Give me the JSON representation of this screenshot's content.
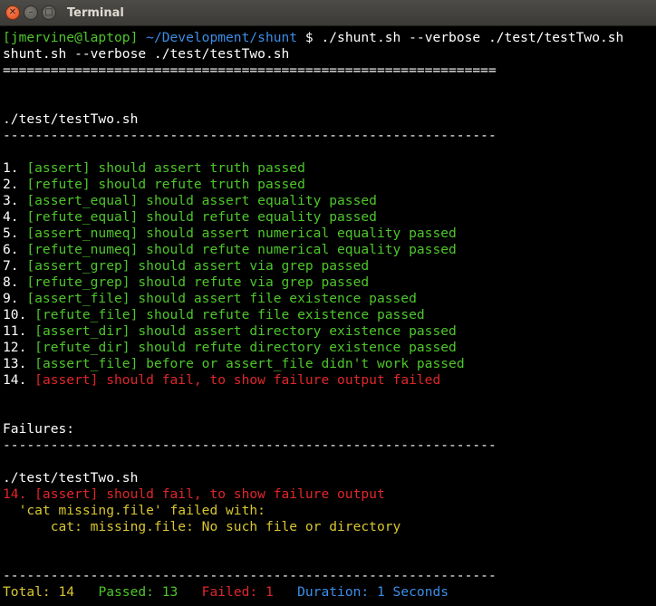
{
  "window": {
    "title": "Terminal",
    "buttons": {
      "close": "✕",
      "minimize": "–",
      "maximize": "□"
    }
  },
  "prompt": {
    "user_host": "[jmervine@laptop]",
    "path": " ~/Development/shunt",
    "symbol": " $ ",
    "command": "./shunt.sh --verbose ./test/testTwo.sh"
  },
  "echo_line": "shunt.sh --verbose ./test/testTwo.sh",
  "separator_double": "==============================================================",
  "section_file": "./test/testTwo.sh",
  "separator_dash": "--------------------------------------------------------------",
  "results": [
    {
      "num": "1. ",
      "text": "[assert] should assert truth passed",
      "status": "pass"
    },
    {
      "num": "2. ",
      "text": "[refute] should refute truth passed",
      "status": "pass"
    },
    {
      "num": "3. ",
      "text": "[assert_equal] should assert equality passed",
      "status": "pass"
    },
    {
      "num": "4. ",
      "text": "[refute_equal] should refute equality passed",
      "status": "pass"
    },
    {
      "num": "5. ",
      "text": "[assert_numeq] should assert numerical equality passed",
      "status": "pass"
    },
    {
      "num": "6. ",
      "text": "[refute_numeq] should refute numerical equality passed",
      "status": "pass"
    },
    {
      "num": "7. ",
      "text": "[assert_grep] should assert via grep passed",
      "status": "pass"
    },
    {
      "num": "8. ",
      "text": "[refute_grep] should refute via grep passed",
      "status": "pass"
    },
    {
      "num": "9. ",
      "text": "[assert_file] should assert file existence passed",
      "status": "pass"
    },
    {
      "num": "10. ",
      "text": "[refute_file] should refute file existence passed",
      "status": "pass"
    },
    {
      "num": "11. ",
      "text": "[assert_dir] should assert directory existence passed",
      "status": "pass"
    },
    {
      "num": "12. ",
      "text": "[refute_dir] should refute directory existence passed",
      "status": "pass"
    },
    {
      "num": "13. ",
      "text": "[assert_file] before or assert_file didn't work passed",
      "status": "pass"
    },
    {
      "num": "14. ",
      "text": "[assert] should fail, to show failure output failed",
      "status": "fail"
    }
  ],
  "failures": {
    "heading": "Failures:",
    "file": "./test/testTwo.sh",
    "item": "14. [assert] should fail, to show failure output",
    "detail_1": "  'cat missing.file' failed with:",
    "detail_2": "      cat: missing.file: No such file or directory"
  },
  "summary": {
    "total": "Total: 14",
    "passed": "Passed: 13",
    "failed": "Failed: 1",
    "duration_label": "Duration:",
    "duration_value": " 1 Seconds"
  },
  "colors": {
    "pass": "#4ec62b",
    "fail": "#e0262b",
    "detail": "#d9c630",
    "path": "#3b8ee8",
    "background": "#000000"
  }
}
